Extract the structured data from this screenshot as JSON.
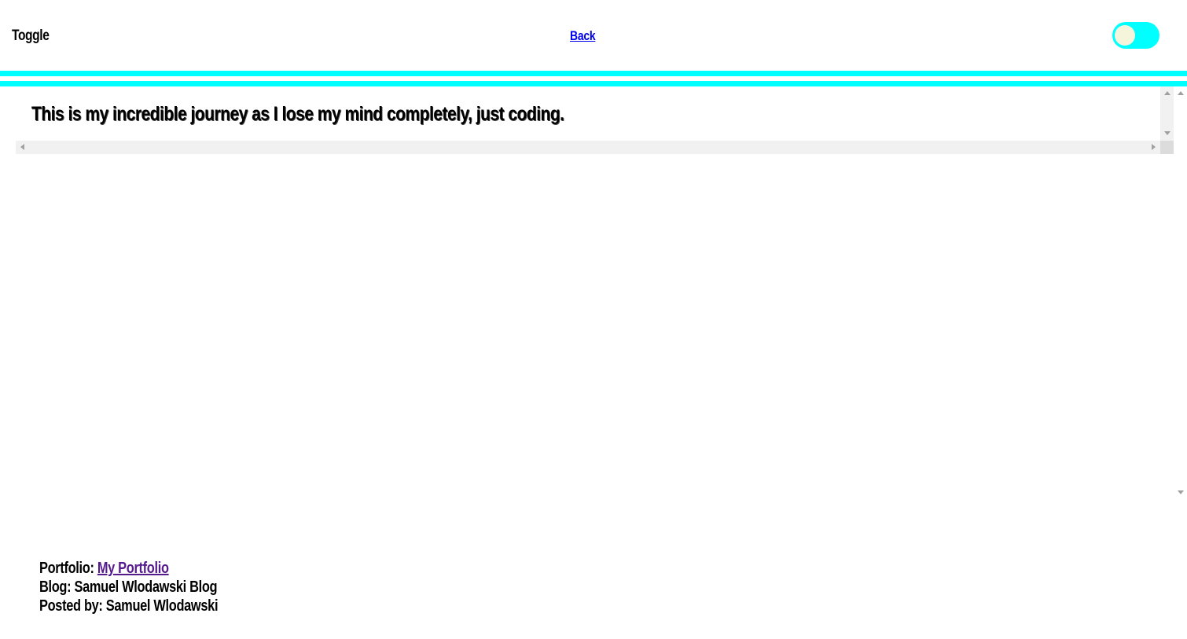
{
  "header": {
    "toggle_label": "Toggle",
    "back_link": "Back",
    "switch_color": "#00ffff",
    "knob_color": "#f5f5dc"
  },
  "main": {
    "journey_text": "This is my incredible journey as I lose my mind completely, just coding."
  },
  "footer": {
    "portfolio_label": "Portfolio:",
    "portfolio_link": "My Portfolio",
    "blog_line": "Blog: Samuel Wlodawski Blog",
    "posted_by_line": "Posted by: Samuel Wlodawski"
  },
  "colors": {
    "accent": "#00ffff",
    "link": "#0000ee",
    "visited_link": "#551a8b"
  }
}
